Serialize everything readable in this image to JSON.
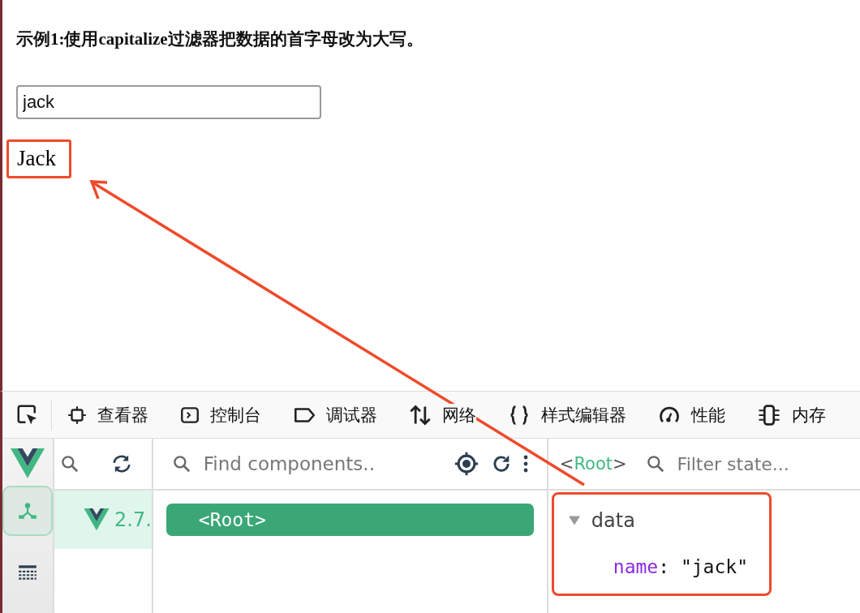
{
  "page": {
    "heading": "示例1:使用capitalize过滤器把数据的首字母改为大写。",
    "input": {
      "value": "jack"
    },
    "output": "Jack"
  },
  "devtools": {
    "tabs": [
      {
        "kind": "inspector",
        "label": "查看器",
        "selected": false
      },
      {
        "kind": "console",
        "label": "控制台",
        "selected": false
      },
      {
        "kind": "debugger",
        "label": "调试器",
        "selected": false
      },
      {
        "kind": "network",
        "label": "网络",
        "selected": false
      },
      {
        "kind": "style",
        "label": "样式编辑器",
        "selected": false
      },
      {
        "kind": "performance",
        "label": "性能",
        "selected": false
      },
      {
        "kind": "memory",
        "label": "内存",
        "selected": false
      }
    ],
    "vue": {
      "nav": [
        {
          "kind": "components",
          "selected": true
        },
        {
          "kind": "timeline",
          "selected": false
        }
      ],
      "app": {
        "version": "2.7.",
        "selected": true
      },
      "search": {
        "placeholder": "Find components.."
      },
      "tree": [
        {
          "label": "<Root>",
          "selected": true
        }
      ],
      "inspector": {
        "open": "<",
        "name": "Root",
        "close": ">",
        "filter_placeholder": "Filter state...",
        "sections": [
          {
            "title": "data",
            "expanded": true,
            "props": [
              {
                "key": "name",
                "sep": ":",
                "value": "\"jack\""
              }
            ]
          }
        ]
      }
    }
  }
}
